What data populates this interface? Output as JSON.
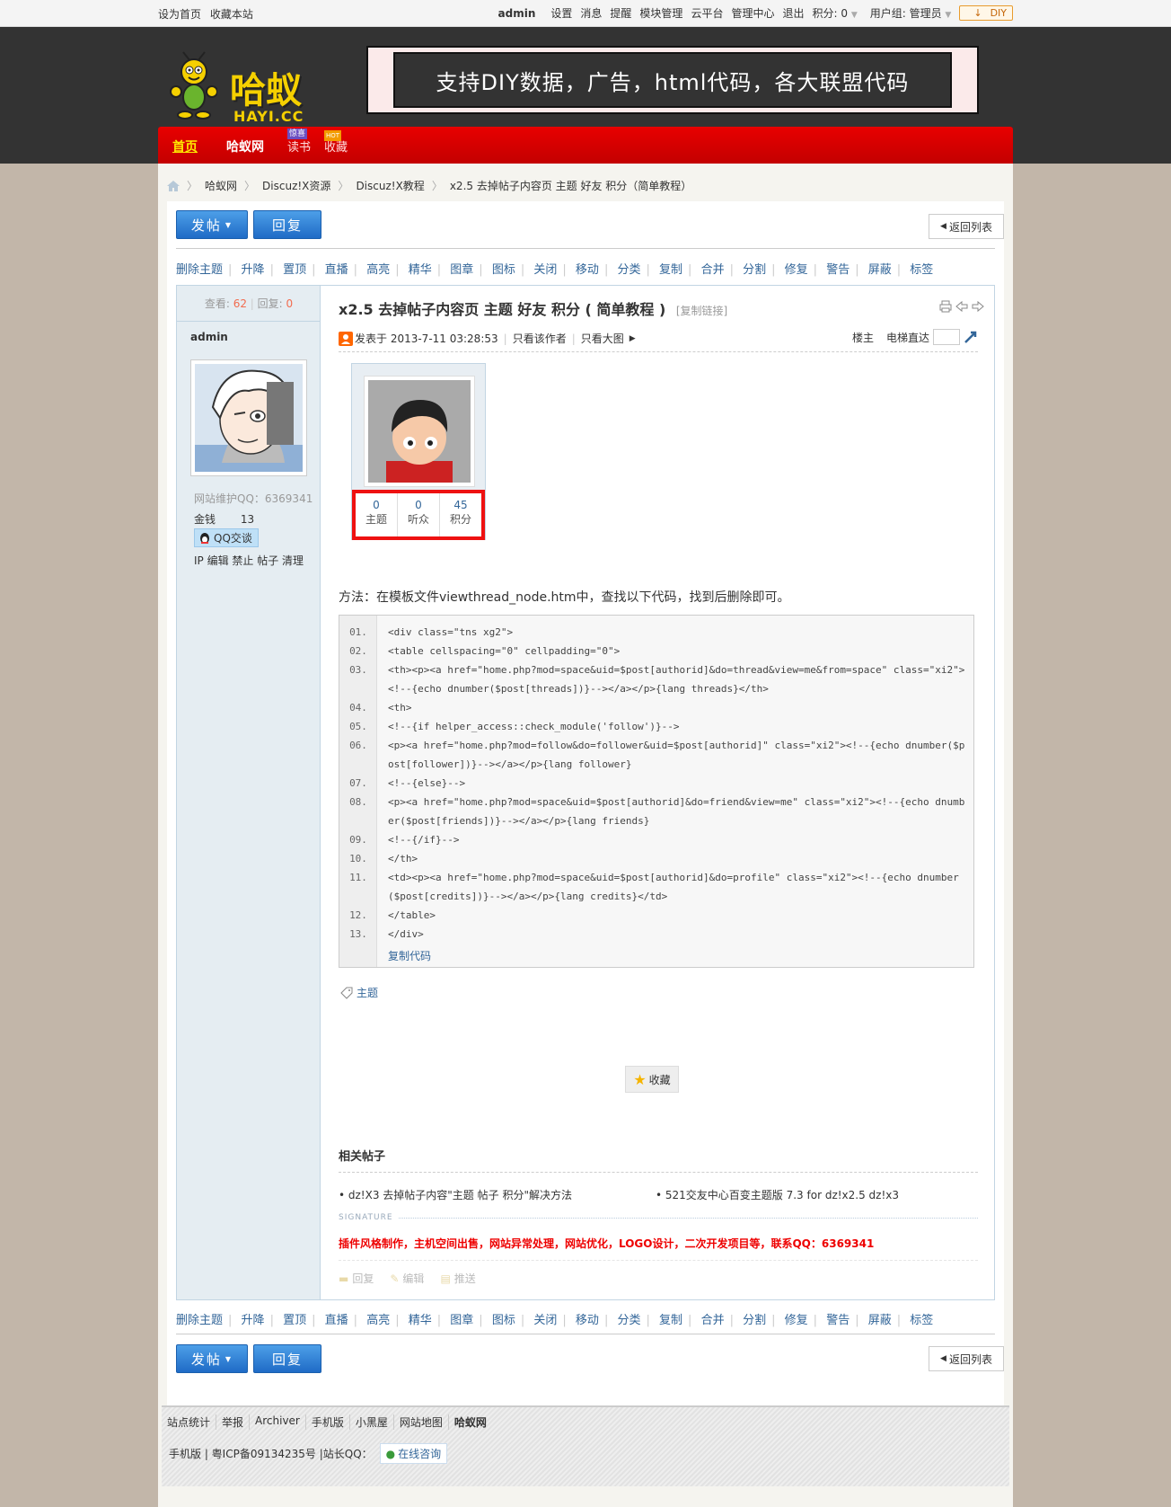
{
  "topbar": {
    "left": [
      "设为首页",
      "收藏本站"
    ],
    "username": "admin",
    "links": [
      "设置",
      "消息",
      "提醒",
      "模块管理",
      "云平台",
      "管理中心",
      "退出"
    ],
    "credits": "积分: 0",
    "usergroup": "用户组: 管理员",
    "diy": "DIY"
  },
  "header": {
    "logo_cn": "哈蚁",
    "logo_en": "HAYI.CC",
    "banner": "支持DIY数据，广告，html代码，各大联盟代码"
  },
  "nav": {
    "items": [
      "首页",
      "哈蚁网",
      "读书",
      "收藏"
    ],
    "badge_read": "惊喜",
    "badge_fav": "HOT"
  },
  "breadcrumb": [
    "哈蚁网",
    "Discuz!X资源",
    "Discuz!X教程",
    "x2.5 去掉帖子内容页 主题 好友 积分（简单教程）"
  ],
  "buttons": {
    "post": "发帖",
    "reply": "回复",
    "back": "返回列表"
  },
  "modbar": [
    "删除主题",
    "升降",
    "置顶",
    "直播",
    "高亮",
    "精华",
    "图章",
    "图标",
    "关闭",
    "移动",
    "分类",
    "复制",
    "合并",
    "分割",
    "修复",
    "警告",
    "屏蔽",
    "标签"
  ],
  "sidebar": {
    "views_label": "查看:",
    "views": "62",
    "replies_label": "回复:",
    "replies": "0",
    "author": "admin",
    "qq_label": "网站维护QQ：6369341",
    "money_label": "金钱",
    "money": "13",
    "qq_chat": "QQ交谈",
    "admin_links": "IP 编辑 禁止 帖子 清理"
  },
  "post": {
    "title": "x2.5 去掉帖子内容页 主题 好友 积分 ( 简单教程 )",
    "copy_link": "[复制链接]",
    "posted": "发表于 2013-7-11 03:28:53",
    "only_author": "只看该作者",
    "only_big": "只看大图",
    "floor": "楼主",
    "jump": "电梯直达",
    "stats": [
      {
        "value": "0",
        "label": "主题"
      },
      {
        "value": "0",
        "label": "听众"
      },
      {
        "value": "45",
        "label": "积分"
      }
    ],
    "description": "方法：在模板文件viewthread_node.htm中，查找以下代码，找到后删除即可。",
    "code_lines": [
      {
        "n": "01.",
        "t": "<div class=\"tns xg2\">"
      },
      {
        "n": "02.",
        "t": "<table cellspacing=\"0\" cellpadding=\"0\">"
      },
      {
        "n": "03.",
        "t": "<th><p><a href=\"home.php?mod=space&uid=$post[authorid]&do=thread&view=me&from=space\" class=\"xi2\"><!--{echo dnumber($post[threads])}--></a></p>{lang threads}</th>"
      },
      {
        "n": "04.",
        "t": "<th>"
      },
      {
        "n": "05.",
        "t": "<!--{if helper_access::check_module('follow')}-->"
      },
      {
        "n": "06.",
        "t": "<p><a href=\"home.php?mod=follow&do=follower&uid=$post[authorid]\" class=\"xi2\"><!--{echo dnumber($post[follower])}--></a></p>{lang follower}"
      },
      {
        "n": "07.",
        "t": "<!--{else}-->"
      },
      {
        "n": "08.",
        "t": "<p><a href=\"home.php?mod=space&uid=$post[authorid]&do=friend&view=me\" class=\"xi2\"><!--{echo dnumber($post[friends])}--></a></p>{lang friends}"
      },
      {
        "n": "09.",
        "t": "<!--{/if}-->"
      },
      {
        "n": "10.",
        "t": "</th>"
      },
      {
        "n": "11.",
        "t": "<td><p><a href=\"home.php?mod=space&uid=$post[authorid]&do=profile\" class=\"xi2\"><!--{echo dnumber($post[credits])}--></a></p>{lang credits}</td>"
      },
      {
        "n": "12.",
        "t": "</table>"
      },
      {
        "n": "13.",
        "t": "</div>"
      }
    ],
    "copy_code": "复制代码",
    "tag": "主题",
    "favorite": "收藏",
    "related_title": "相关帖子",
    "related": [
      "• dz!X3 去掉帖子内容\"主题 帖子 积分\"解决方法",
      "• 521交友中心百变主题版 7.3 for dz!x2.5 dz!x3"
    ],
    "signature_label": "SIGNATURE",
    "signature": "插件风格制作，主机空间出售，网站异常处理，网站优化，LOGO设计，二次开发项目等，联系QQ：6369341",
    "actions": [
      "回复",
      "编辑",
      "推送"
    ]
  },
  "footer": {
    "links": [
      "站点统计",
      "举报",
      "Archiver",
      "手机版",
      "小黑屋",
      "网站地图",
      "哈蚁网"
    ],
    "line2": "手机版 | 粤ICP备09134235号 |站长QQ：",
    "online": "在线咨询"
  }
}
